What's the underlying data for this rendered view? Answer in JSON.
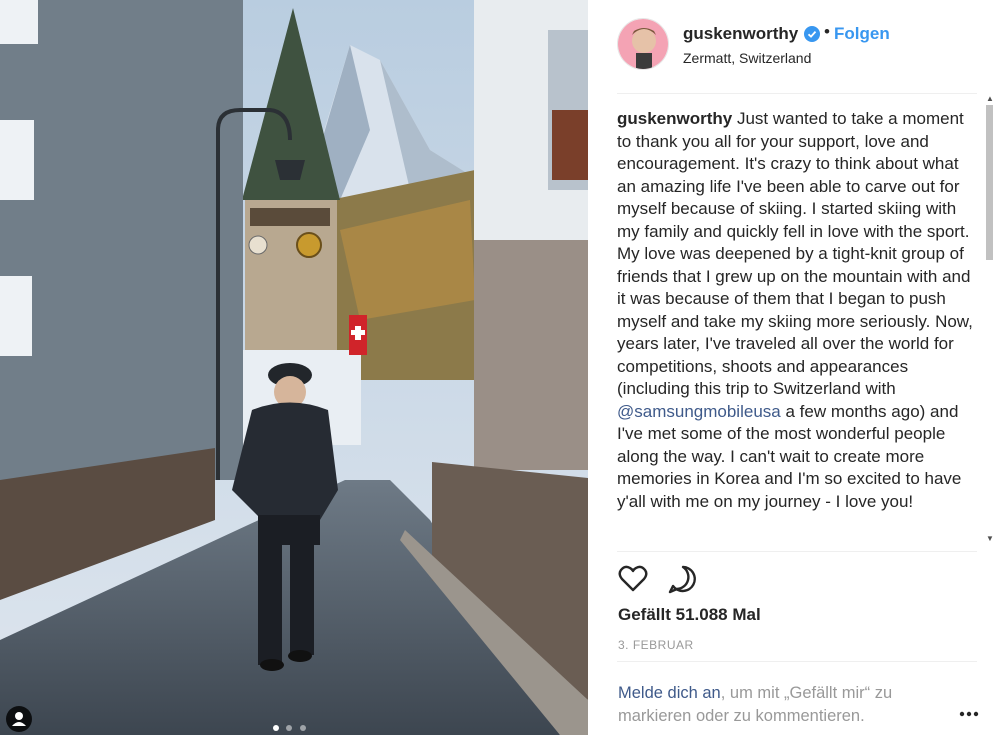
{
  "post": {
    "username": "guskenworthy",
    "follow_label": "Folgen",
    "separator": "•",
    "location": "Zermatt, Switzerland"
  },
  "caption": {
    "username": "guskenworthy",
    "text_before_mention": " Just wanted to take a moment to thank you all for your support, love and encouragement. It's crazy to think about what an amazing life I've been able to carve out for myself because of skiing. I started skiing with my family and quickly fell in love with the sport. My love was deepened by a tight-knit group of friends that I grew up on the mountain with and it was because of them that I began to push myself and take my skiing more seriously. Now, years later, I've traveled all over the world for competitions, shoots and appearances (including this trip to Switzerland with ",
    "mention": "@samsungmobileusa",
    "text_after_mention": " a few months ago) and I've met some of the most wonderful people along the way. I can't wait to create more memories in Korea and I'm so excited to have y'all with me on my journey - I love you!"
  },
  "engagement": {
    "likes_text": "Gefällt 51.088 Mal",
    "date": "3. FEBRUAR"
  },
  "footer": {
    "login_link": "Melde dich an",
    "login_rest": ", um mit „Gefällt mir“ zu markieren oder zu kommentieren."
  },
  "carousel": {
    "count": 3,
    "active_index": 0
  },
  "icons": {
    "verified": "verified-badge-icon",
    "like": "heart-icon",
    "comment": "comment-icon",
    "more": "more-options-icon",
    "tag": "user-tag-icon"
  },
  "colors": {
    "link_blue": "#3897f0",
    "text": "#262626",
    "muted": "#999999",
    "mention": "#3f5a8a"
  }
}
